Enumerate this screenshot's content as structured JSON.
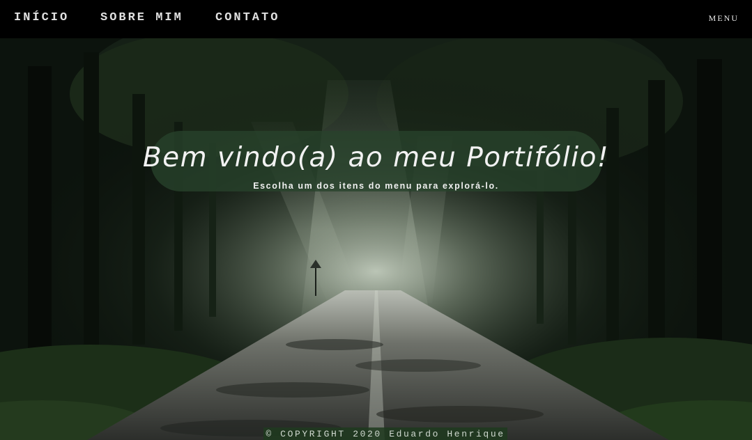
{
  "nav": {
    "links": [
      {
        "label": "INÍCIO"
      },
      {
        "label": "SOBRE MIM"
      },
      {
        "label": "CONTATO"
      }
    ],
    "menu_label": "MENU"
  },
  "hero": {
    "title": "Bem vindo(a) ao meu Portifólio!",
    "subtitle": "Escolha um dos itens do menu para explorá-lo."
  },
  "footer": {
    "copyright": "© COPYRIGHT 2020 Eduardo Henrique"
  },
  "colors": {
    "navbar": "#000000",
    "panel": "#28422c",
    "footer": "#1e3a1e",
    "text": "#f2f2f2"
  }
}
